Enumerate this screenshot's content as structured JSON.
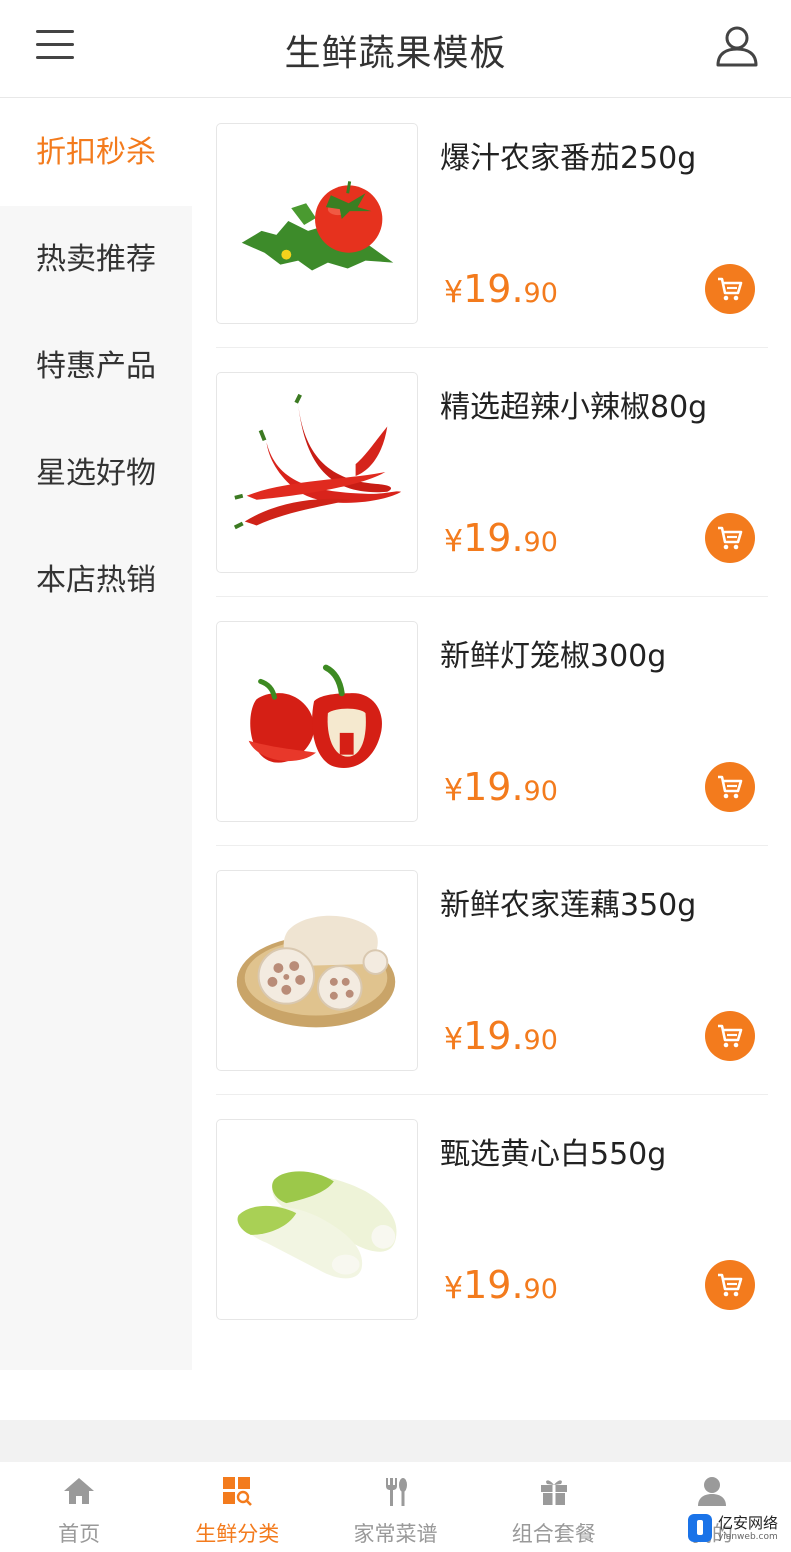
{
  "header": {
    "title": "生鲜蔬果模板",
    "menu_icon": "hamburger-menu-icon",
    "user_icon": "user-profile-icon"
  },
  "sidebar": {
    "items": [
      {
        "label": "折扣秒杀",
        "active": true
      },
      {
        "label": "热卖推荐",
        "active": false
      },
      {
        "label": "特惠产品",
        "active": false
      },
      {
        "label": "星选好物",
        "active": false
      },
      {
        "label": "本店热销",
        "active": false
      }
    ]
  },
  "products": [
    {
      "name": "爆汁农家番茄250g",
      "currency": "¥",
      "price_int": "19.",
      "price_dec": "90",
      "image": "tomato"
    },
    {
      "name": "精选超辣小辣椒80g",
      "currency": "¥",
      "price_int": "19.",
      "price_dec": "90",
      "image": "red-chili"
    },
    {
      "name": "新鲜灯笼椒300g",
      "currency": "¥",
      "price_int": "19.",
      "price_dec": "90",
      "image": "bell-pepper"
    },
    {
      "name": "新鲜农家莲藕350g",
      "currency": "¥",
      "price_int": "19.",
      "price_dec": "90",
      "image": "lotus-root"
    },
    {
      "name": "甄选黄心白550g",
      "currency": "¥",
      "price_int": "19.",
      "price_dec": "90",
      "image": "napa-cabbage"
    }
  ],
  "tabbar": {
    "tabs": [
      {
        "label": "首页",
        "icon": "home-icon",
        "active": false
      },
      {
        "label": "生鲜分类",
        "icon": "category-icon",
        "active": true
      },
      {
        "label": "家常菜谱",
        "icon": "cutlery-icon",
        "active": false
      },
      {
        "label": "组合套餐",
        "icon": "gift-icon",
        "active": false
      },
      {
        "label": "我的",
        "icon": "user-icon",
        "active": false
      }
    ]
  },
  "watermark": {
    "text": "亿安网络",
    "sub": "yianweb.com"
  },
  "colors": {
    "accent": "#f37b1d",
    "sidebar_bg": "#f7f7f7",
    "inactive_text": "#999999"
  }
}
